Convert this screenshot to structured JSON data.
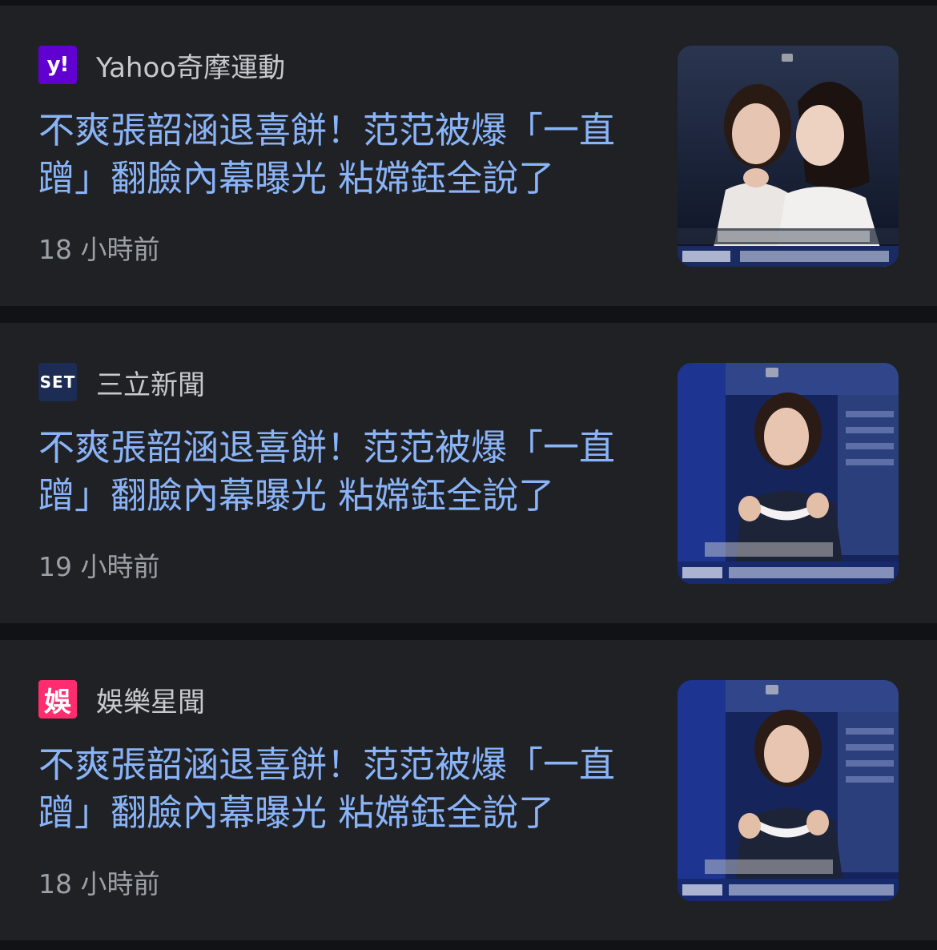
{
  "cards": [
    {
      "source_logo_text": "y!",
      "source_name": "Yahoo奇摩運動",
      "headline": "不爽張韶涵退喜餅！范范被爆「一直蹭」翻臉內幕曝光 粘嫦鈺全說了",
      "time": "18 小時前"
    },
    {
      "source_logo_text": "SET",
      "source_name": "三立新聞",
      "headline": "不爽張韶涵退喜餅！范范被爆「一直蹭」翻臉內幕曝光 粘嫦鈺全說了",
      "time": "19 小時前"
    },
    {
      "source_logo_text": "娛",
      "source_name": "娛樂星聞",
      "headline": "不爽張韶涵退喜餅！范范被爆「一直蹭」翻臉內幕曝光 粘嫦鈺全說了",
      "time": "18 小時前"
    }
  ],
  "colors": {
    "background": "#111215",
    "card": "#202125",
    "headline": "#8ab4f8",
    "source_text": "#c7c9ce",
    "time_text": "#9aa0a6",
    "yahoo_logo": "#6001d2",
    "set_logo": "#1d2c55",
    "ent_logo": "#ff2d6f"
  }
}
